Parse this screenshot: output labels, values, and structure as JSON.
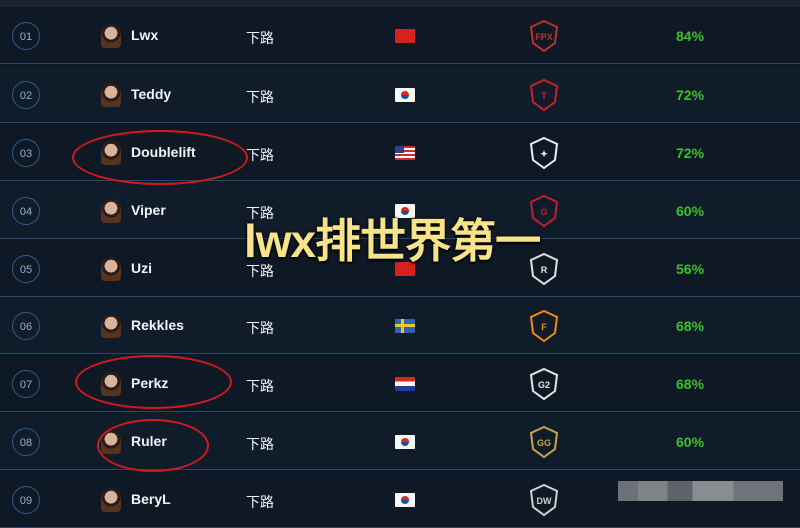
{
  "players": [
    {
      "rank": "01",
      "name": "Lwx",
      "role": "下路",
      "flag": "cn",
      "team": "FPX",
      "team_color": "#b8342a",
      "winrate": "84%"
    },
    {
      "rank": "02",
      "name": "Teddy",
      "role": "下路",
      "flag": "kr",
      "team": "SKT",
      "team_color": "#c8202a",
      "winrate": "72%"
    },
    {
      "rank": "03",
      "name": "Doublelift",
      "role": "下路",
      "flag": "us",
      "team": "teamliquid",
      "team_color": "#e9eef5",
      "winrate": "72%"
    },
    {
      "rank": "04",
      "name": "Viper",
      "role": "下路",
      "flag": "kr",
      "team": "GRF",
      "team_color": "#c1202b",
      "winrate": "60%"
    },
    {
      "rank": "05",
      "name": "Uzi",
      "role": "下路",
      "flag": "cn",
      "team": "RNG",
      "team_color": "#e2e2e2",
      "winrate": "56%"
    },
    {
      "rank": "06",
      "name": "Rekkles",
      "role": "下路",
      "flag": "se",
      "team": "FNATIC",
      "team_color": "#f08a16",
      "winrate": "68%"
    },
    {
      "rank": "07",
      "name": "Perkz",
      "role": "下路",
      "flag": "hr",
      "team": "G2",
      "team_color": "#e6e6e6",
      "winrate": "68%"
    },
    {
      "rank": "08",
      "name": "Ruler",
      "role": "下路",
      "flag": "kr",
      "team": "GEN.G",
      "team_color": "#c8a64b",
      "winrate": "60%"
    },
    {
      "rank": "09",
      "name": "BeryL",
      "role": "下路",
      "flag": "kr",
      "team": "DAMWON",
      "team_color": "#d0d0d0",
      "winrate": ""
    }
  ],
  "overlay": {
    "text": "lwx排世界第一"
  },
  "colors": {
    "winrate": "#39c22a",
    "circle": "#d3191c",
    "overlay_text": "#f7e48a"
  }
}
